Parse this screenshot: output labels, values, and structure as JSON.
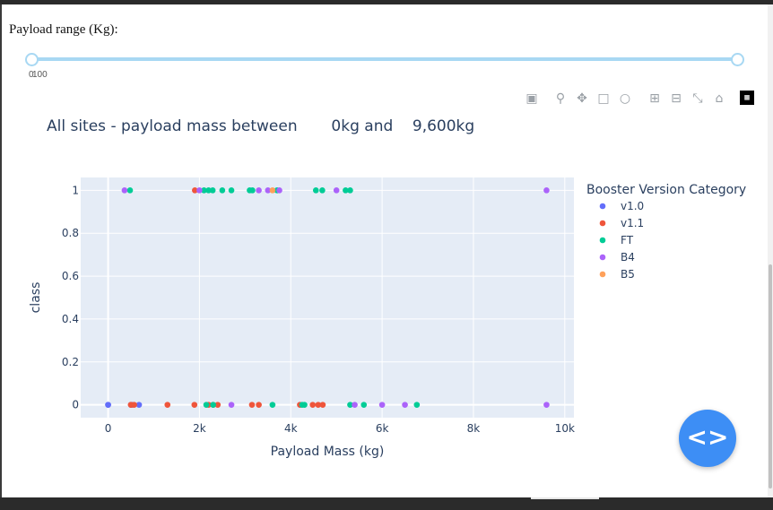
{
  "slider": {
    "label": "Payload range (Kg):",
    "min_mark": "0",
    "max_mark": "100",
    "value_low": 0,
    "value_high": 9600
  },
  "modebar": {
    "icons": [
      "camera-icon",
      "zoom-icon",
      "pan-icon",
      "box-select-icon",
      "lasso-icon",
      "zoom-in-icon",
      "zoom-out-icon",
      "autoscale-icon",
      "reset-axes-icon",
      "plotly-logo"
    ]
  },
  "code_button": {
    "label": "<>"
  },
  "chart_data": {
    "type": "scatter",
    "title": "All sites - payload mass between       0kg and    9,600kg",
    "xlabel": "Payload Mass (kg)",
    "ylabel": "class",
    "xlim": [
      -600,
      10200
    ],
    "ylim": [
      -0.06,
      1.06
    ],
    "xticks": [
      0,
      2000,
      4000,
      6000,
      8000,
      10000
    ],
    "xtick_labels": [
      "0",
      "2k",
      "4k",
      "6k",
      "8k",
      "10k"
    ],
    "yticks": [
      0,
      0.2,
      0.4,
      0.6,
      0.8,
      1
    ],
    "ytick_labels": [
      "0",
      "0.2",
      "0.4",
      "0.6",
      "0.8",
      "1"
    ],
    "grid": true,
    "legend_title": "Booster Version Category",
    "legend_position": "right",
    "series": [
      {
        "name": "v1.0",
        "color": "#636efa",
        "points": [
          [
            0,
            0
          ],
          [
            0,
            0
          ],
          [
            525,
            0
          ],
          [
            677,
            0
          ],
          [
            500,
            0
          ]
        ]
      },
      {
        "name": "v1.1",
        "color": "#EF553B",
        "points": [
          [
            500,
            0
          ],
          [
            570,
            0
          ],
          [
            1300,
            0
          ],
          [
            1900,
            1
          ],
          [
            1890,
            0
          ],
          [
            2200,
            0
          ],
          [
            2300,
            0
          ],
          [
            2400,
            0
          ],
          [
            3150,
            0
          ],
          [
            3300,
            0
          ],
          [
            4200,
            0
          ],
          [
            4480,
            0
          ],
          [
            4600,
            0
          ],
          [
            4700,
            0
          ],
          [
            500,
            0
          ]
        ]
      },
      {
        "name": "FT",
        "color": "#00cc96",
        "points": [
          [
            480,
            1
          ],
          [
            2100,
            1
          ],
          [
            2200,
            1
          ],
          [
            2290,
            1
          ],
          [
            2500,
            1
          ],
          [
            2700,
            1
          ],
          [
            3100,
            1
          ],
          [
            3160,
            1
          ],
          [
            3700,
            1
          ],
          [
            4550,
            1
          ],
          [
            4690,
            1
          ],
          [
            5200,
            1
          ],
          [
            5300,
            1
          ],
          [
            2150,
            0
          ],
          [
            2300,
            0
          ],
          [
            3600,
            0
          ],
          [
            4250,
            0
          ],
          [
            4300,
            0
          ],
          [
            5300,
            0
          ],
          [
            5600,
            0
          ],
          [
            6760,
            0
          ]
        ]
      },
      {
        "name": "B4",
        "color": "#ab63fa",
        "points": [
          [
            360,
            1
          ],
          [
            2000,
            1
          ],
          [
            3300,
            1
          ],
          [
            3500,
            1
          ],
          [
            3750,
            1
          ],
          [
            5000,
            1
          ],
          [
            9600,
            1
          ],
          [
            2700,
            0
          ],
          [
            5400,
            0
          ],
          [
            6000,
            0
          ],
          [
            6500,
            0
          ],
          [
            9600,
            0
          ]
        ]
      },
      {
        "name": "B5",
        "color": "#FFA15A",
        "points": [
          [
            3600,
            1
          ]
        ]
      }
    ]
  }
}
